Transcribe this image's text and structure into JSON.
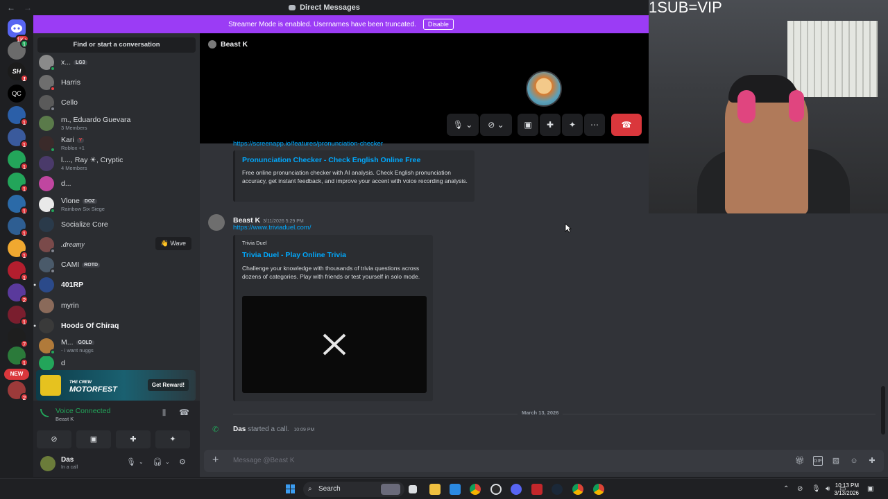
{
  "titlebar": {
    "title": "Direct Messages",
    "back": "←",
    "forward": "→"
  },
  "banner": {
    "text": "Streamer Mode is enabled. Usernames have been truncated.",
    "button": "Disable"
  },
  "rail": {
    "home_badge": "1K+",
    "new_label": "NEW",
    "badges": [
      "1",
      "1",
      "1",
      "1",
      "1",
      "1",
      "1",
      "1",
      "1",
      "1",
      "2",
      "1",
      "7",
      "1",
      "2"
    ]
  },
  "dm_sidebar": {
    "search": "Find or start a conversation",
    "items": [
      {
        "name": "x...",
        "tag": "LG3",
        "sub": ""
      },
      {
        "name": "Harris",
        "sub": ""
      },
      {
        "name": "Cello",
        "sub": ""
      },
      {
        "name": "m., Eduardo Guevara",
        "sub": "3 Members"
      },
      {
        "name": "Kari",
        "tag": "Y",
        "sub": "Roblox +1"
      },
      {
        "name": "l...., Ray ☀, Cryptic",
        "sub": "4 Members"
      },
      {
        "name": "d...",
        "sub": ""
      },
      {
        "name": "Vlone",
        "tag": "DOZ",
        "sub": "Rainbow Six Siege"
      },
      {
        "name": "Socialize Core",
        "sub": ""
      },
      {
        "name": ".dreamy",
        "sub": "",
        "wave": "👋 Wave"
      },
      {
        "name": "CAMI",
        "tag": "ROTD",
        "sub": ""
      },
      {
        "name": "401RP",
        "sub": ""
      },
      {
        "name": "myrin",
        "sub": ""
      },
      {
        "name": "Hoods Of Chiraq",
        "sub": ""
      },
      {
        "name": "M...",
        "tag": "GOLD",
        "sub": "- i want nuggs"
      },
      {
        "name": "d",
        "sub": ""
      }
    ],
    "promo": {
      "logo_top": "THE CREW",
      "logo": "MOTORFEST",
      "button": "Get Reward!"
    },
    "voice": {
      "status": "Voice Connected",
      "channel": "Beast K"
    },
    "user": {
      "name": "Das",
      "status": "In a call"
    }
  },
  "chat": {
    "header_name": "Beast K",
    "partial_link": "https://screenapp.io/features/pronunciation-checker",
    "embed1": {
      "title": "Pronunciation Checker - Check English Online Free",
      "desc": "Free online pronunciation checker with AI analysis. Check English pronunciation accuracy, get instant feedback, and improve your accent with voice recording analysis."
    },
    "message2": {
      "author": "Beast K",
      "timestamp": "3/11/2026 5:29 PM",
      "link": "https://www.triviaduel.com/",
      "embed": {
        "provider": "Trivia Duel",
        "title": "Trivia Duel - Play Online Trivia",
        "desc": "Challenge your knowledge with thousands of trivia questions across dozens of categories. Play with friends or test yourself in solo mode."
      }
    },
    "date_divider": "March 13, 2026",
    "system": {
      "name": "Das",
      "text": "started a call.",
      "time": "10:09 PM"
    },
    "input_placeholder": "Message @Beast K"
  },
  "overlay": {
    "text": "1SUB=VIP"
  },
  "taskbar": {
    "search": "Search",
    "time": "10:13 PM",
    "date": "3/13/2026"
  },
  "colors": {
    "accent": "#9b3cf5",
    "link": "#00a8fc",
    "online": "#23a55a",
    "danger": "#da373c"
  }
}
